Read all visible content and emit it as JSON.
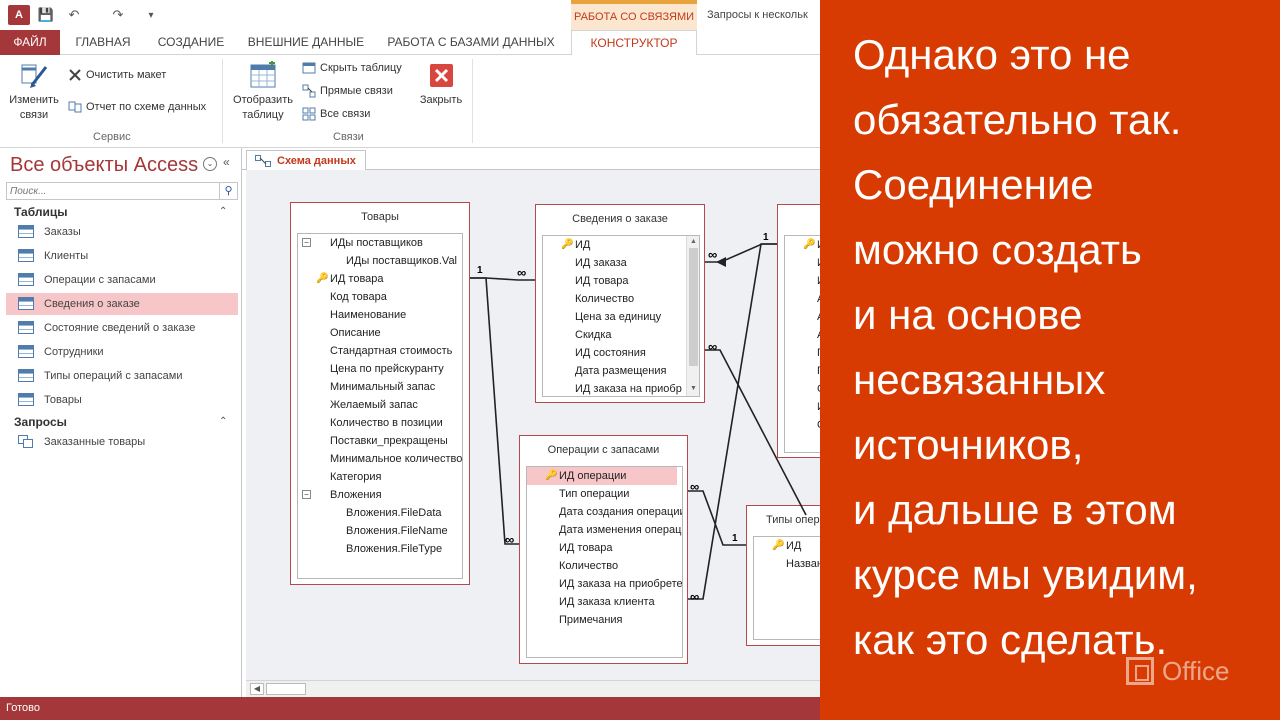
{
  "titlebar": {
    "app_icon": "A",
    "save_icon": "💾",
    "undo_icon": "↶",
    "redo_icon": "↷",
    "more_icon": "▾",
    "context_group": "РАБОТА СО СВЯЗЯМИ",
    "window_title": "Запросы к нескольк"
  },
  "tabs": {
    "file": "ФАЙЛ",
    "home": "ГЛАВНАЯ",
    "create": "СОЗДАНИЕ",
    "external": "ВНЕШНИЕ ДАННЫЕ",
    "database": "РАБОТА С БАЗАМИ ДАННЫХ",
    "design": "КОНСТРУКТОР"
  },
  "ribbon": {
    "edit_relationships": [
      "Изменить",
      "связи"
    ],
    "clear_layout": "Очистить макет",
    "relationship_report": "Отчет по схеме данных",
    "group_tools": "Сервис",
    "show_table": [
      "Отобразить",
      "таблицу"
    ],
    "hide_table": "Скрыть таблицу",
    "direct_relationships": "Прямые связи",
    "all_relationships": "Все связи",
    "close": "Закрыть",
    "group_relationships": "Связи"
  },
  "nav": {
    "title": "Все объекты Access",
    "menu_icon": "⌄",
    "collapse_icon": "«",
    "search_placeholder": "Поиск...",
    "search_icon": "⚲",
    "section_tables": "Таблицы",
    "section_queries": "Запросы",
    "section_chevron": "⌃",
    "tables": [
      "Заказы",
      "Клиенты",
      "Операции с запасами",
      "Сведения о заказе",
      "Состояние сведений о заказе",
      "Сотрудники",
      "Типы операций с запасами",
      "Товары"
    ],
    "queries": [
      "Заказанные товары"
    ],
    "selected": "Сведения о заказе"
  },
  "document": {
    "tab_label": "Схема данных"
  },
  "diagram": {
    "products": {
      "title": "Товары",
      "fields": [
        "ИДы поставщиков",
        "ИДы поставщиков.Val",
        "ИД товара",
        "Код товара",
        "Наименование",
        "Описание",
        "Стандартная стоимость",
        "Цена по прейскуранту",
        "Минимальный запас",
        "Желаемый запас",
        "Количество в позиции",
        "Поставки_прекращены",
        "Минимальное количество",
        "Категория",
        "Вложения",
        "Вложения.FileData",
        "Вложения.FileName",
        "Вложения.FileType"
      ]
    },
    "order_details": {
      "title": "Сведения о заказе",
      "fields": [
        "ИД",
        "ИД заказа",
        "ИД товара",
        "Количество",
        "Цена за единицу",
        "Скидка",
        "ИД состояния",
        "Дата размещения",
        "ИД заказа на приобр"
      ]
    },
    "inventory": {
      "title": "Операции с запасами",
      "fields": [
        "ИД операции",
        "Тип операции",
        "Дата создания операции",
        "Дата изменения операции",
        "ИД товара",
        "Количество",
        "ИД заказа на приобретение",
        "ИД заказа клиента",
        "Примечания"
      ]
    },
    "inventory_types": {
      "title": "Типы операций",
      "fields": [
        "ИД",
        "Название"
      ]
    },
    "partial_table": {
      "fields": [
        "И",
        "И",
        "И",
        "А",
        "А",
        "А",
        "Г",
        "Г",
        "С",
        "И",
        "О"
      ]
    },
    "one_label": "1",
    "many_label": "∞",
    "tree_minus": "−",
    "key_icon": "🔑",
    "scroll_up": "▲",
    "scroll_down": "▼"
  },
  "hscroll_left": "◀",
  "status": "Готово",
  "overlay": {
    "lines": [
      "Однако это не",
      "обязательно так.",
      "Соединение",
      "можно создать",
      "и на основе",
      "несвязанных",
      "источников,",
      "и дальше в этом",
      "курсе мы увидим,",
      "как это сделать."
    ],
    "brand": "Office"
  },
  "colors": {
    "access_red": "#a4373a",
    "overlay_orange": "#d83b01",
    "selection_pink": "#f7c6c8"
  }
}
